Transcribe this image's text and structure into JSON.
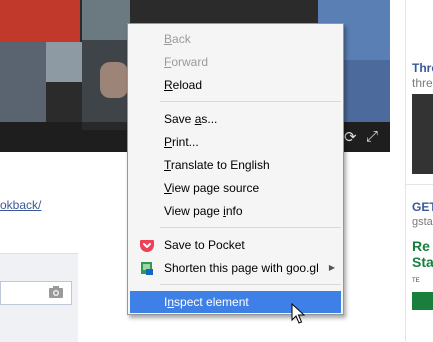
{
  "context_menu": {
    "items": [
      {
        "id": "back",
        "pre": "",
        "key": "B",
        "post": "ack",
        "disabled": true
      },
      {
        "id": "forward",
        "pre": "",
        "key": "F",
        "post": "orward",
        "disabled": true
      },
      {
        "id": "reload",
        "pre": "",
        "key": "R",
        "post": "eload",
        "disabled": false
      },
      {
        "id": "save-as",
        "pre": "Save ",
        "key": "a",
        "post": "s...",
        "disabled": false
      },
      {
        "id": "print",
        "pre": "",
        "key": "P",
        "post": "rint...",
        "disabled": false
      },
      {
        "id": "translate",
        "pre": "",
        "key": "T",
        "post": "ranslate to English",
        "disabled": false
      },
      {
        "id": "view-source",
        "pre": "",
        "key": "V",
        "post": "iew page source",
        "disabled": false
      },
      {
        "id": "view-info",
        "pre": "View page ",
        "key": "i",
        "post": "nfo",
        "disabled": false
      },
      {
        "id": "save-to-pocket",
        "pre": "Save to Pocket",
        "key": "",
        "post": "",
        "disabled": false,
        "icon": "pocket-icon"
      },
      {
        "id": "shorten",
        "pre": "Shorten this page with goo.gl",
        "key": "",
        "post": "",
        "disabled": false,
        "icon": "goo-gl-icon",
        "submenu": true
      },
      {
        "id": "inspect",
        "pre": "I",
        "key": "n",
        "post": "spect element",
        "disabled": false,
        "highlighted": true
      }
    ]
  },
  "page": {
    "link_fragment": "okback/",
    "right_col": {
      "title1": "Thre",
      "sub1": "thre",
      "title2": "GET",
      "sub2": "gsta",
      "ad_line1": "Re",
      "ad_line2": "Sta",
      "ad_small": "TE"
    }
  },
  "colors": {
    "menu_bg": "#f5f5f5",
    "highlight": "#3f80e6",
    "disabled_text": "#9a9a9a",
    "link": "#3b5998",
    "pocket": "#ee4056"
  }
}
